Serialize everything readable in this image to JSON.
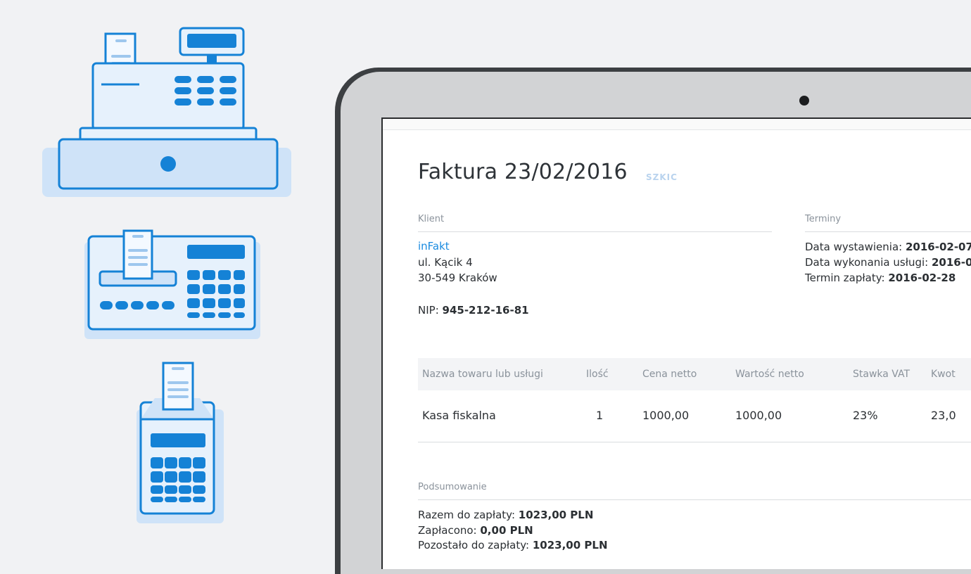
{
  "colors": {
    "background": "#f1f2f4",
    "accent_blue": "#1a8be0",
    "icon_fill": "#e6f1fc",
    "icon_fill_dark": "#cfe3f8",
    "icon_stroke": "#1582d6",
    "badge": "#b9d3ee"
  },
  "icons": [
    "cash-register-icon",
    "fiscal-printer-icon",
    "portable-cash-register-icon"
  ],
  "invoice": {
    "title": "Faktura 23/02/2016",
    "status_badge": "SZKIC",
    "client": {
      "label": "Klient",
      "name": "inFakt",
      "street": "ul. Kącik 4",
      "city": "30-549 Kraków",
      "nip_label": "NIP: ",
      "nip_value": "945-212-16-81"
    },
    "terms": {
      "label": "Terminy",
      "issue_label": "Data wystawienia: ",
      "issue_value": "2016-02-07",
      "service_label": "Data wykonania usługi: ",
      "service_value": "2016-0",
      "due_label": "Termin zapłaty: ",
      "due_value": "2016-02-28"
    },
    "table": {
      "headers": [
        "Nazwa towaru lub usługi",
        "Ilość",
        "Cena netto",
        "Wartość netto",
        "Stawka VAT",
        "Kwot"
      ],
      "rows": [
        [
          "Kasa fiskalna",
          "1",
          "1000,00",
          "1000,00",
          "23%",
          "23,0"
        ]
      ]
    },
    "summary": {
      "label": "Podsumowanie",
      "total_label": "Razem do zapłaty: ",
      "total_value": "1023,00 PLN",
      "paid_label": "Zapłacono: ",
      "paid_value": "0,00 PLN",
      "remaining_label": "Pozostało do zapłaty: ",
      "remaining_value": "1023,00 PLN"
    }
  }
}
